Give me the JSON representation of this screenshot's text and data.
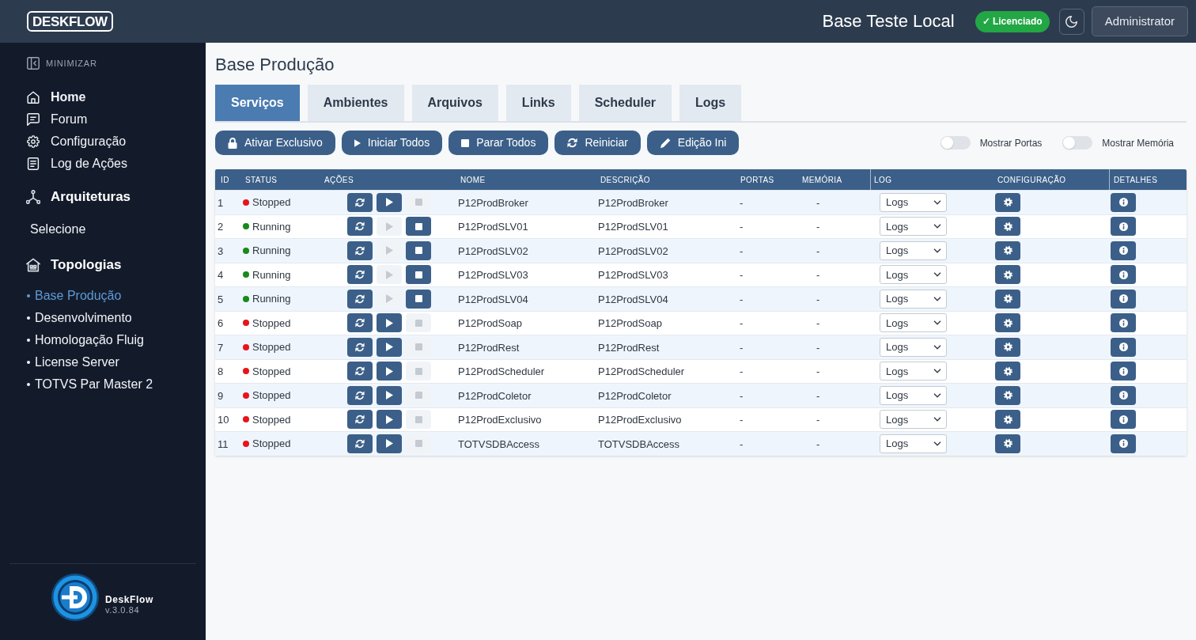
{
  "header": {
    "logo": "DESKFLOW",
    "title": "Base Teste Local",
    "license_badge": "✓ Licenciado",
    "user_button": "Administrator"
  },
  "sidebar": {
    "minimize_label": "MINIMIZAR",
    "nav": [
      {
        "label": "Home",
        "selected": true,
        "kind": "home"
      },
      {
        "label": "Forum",
        "selected": false,
        "kind": "forum"
      },
      {
        "label": "Configuração",
        "selected": false,
        "kind": "settings"
      },
      {
        "label": "Log de Ações",
        "selected": false,
        "kind": "log"
      }
    ],
    "architectures": {
      "title": "Arquiteturas",
      "select_value": "Selecione"
    },
    "topologies": {
      "title": "Topologias",
      "items": [
        {
          "label": "Base Produção",
          "selected": true
        },
        {
          "label": "Desenvolvimento",
          "selected": false
        },
        {
          "label": "Homologação Fluig",
          "selected": false
        },
        {
          "label": "License Server",
          "selected": false
        },
        {
          "label": "TOTVS Par Master 2",
          "selected": false
        }
      ]
    },
    "footer": {
      "app_name": "DeskFlow",
      "version": "v.3.0.84"
    }
  },
  "page": {
    "title": "Base Produção",
    "tabs": [
      {
        "label": "Serviços",
        "selected": true
      },
      {
        "label": "Ambientes",
        "selected": false
      },
      {
        "label": "Arquivos",
        "selected": false
      },
      {
        "label": "Links",
        "selected": false
      },
      {
        "label": "Scheduler",
        "selected": false
      },
      {
        "label": "Logs",
        "selected": false
      }
    ],
    "toolbar": [
      {
        "label": "Ativar Exclusivo",
        "kind": "lock"
      },
      {
        "label": "Iniciar Todos",
        "kind": "start"
      },
      {
        "label": "Parar Todos",
        "kind": "stop"
      },
      {
        "label": "Reiniciar",
        "kind": "restart"
      },
      {
        "label": "Edição Ini",
        "kind": "edit"
      }
    ],
    "toggles": [
      {
        "label": "Mostrar Portas",
        "on": false
      },
      {
        "label": "Mostrar Memória",
        "on": false
      }
    ]
  },
  "table": {
    "columns": [
      "ID",
      "STATUS",
      "AÇÕES",
      "NOME",
      "DESCRIÇÃO",
      "PORTAS",
      "MEMÓRIA",
      "LOG",
      "CONFIGURAÇÃO",
      "DETALHES"
    ],
    "rows": [
      {
        "id": "1",
        "status": "Stopped",
        "color": "#e8141b",
        "running": false,
        "name": "P12ProdBroker",
        "description": "P12ProdBroker",
        "ports": "-",
        "memory": "-",
        "log": "Logs"
      },
      {
        "id": "2",
        "status": "Running",
        "color": "#188a1a",
        "running": true,
        "name": "P12ProdSLV01",
        "description": "P12ProdSLV01",
        "ports": "-",
        "memory": "-",
        "log": "Logs"
      },
      {
        "id": "3",
        "status": "Running",
        "color": "#188a1a",
        "running": true,
        "name": "P12ProdSLV02",
        "description": "P12ProdSLV02",
        "ports": "-",
        "memory": "-",
        "log": "Logs"
      },
      {
        "id": "4",
        "status": "Running",
        "color": "#188a1a",
        "running": true,
        "name": "P12ProdSLV03",
        "description": "P12ProdSLV03",
        "ports": "-",
        "memory": "-",
        "log": "Logs"
      },
      {
        "id": "5",
        "status": "Running",
        "color": "#188a1a",
        "running": true,
        "name": "P12ProdSLV04",
        "description": "P12ProdSLV04",
        "ports": "-",
        "memory": "-",
        "log": "Logs"
      },
      {
        "id": "6",
        "status": "Stopped",
        "color": "#e8141b",
        "running": false,
        "name": "P12ProdSoap",
        "description": "P12ProdSoap",
        "ports": "-",
        "memory": "-",
        "log": "Logs"
      },
      {
        "id": "7",
        "status": "Stopped",
        "color": "#e8141b",
        "running": false,
        "name": "P12ProdRest",
        "description": "P12ProdRest",
        "ports": "-",
        "memory": "-",
        "log": "Logs"
      },
      {
        "id": "8",
        "status": "Stopped",
        "color": "#e8141b",
        "running": false,
        "name": "P12ProdScheduler",
        "description": "P12ProdScheduler",
        "ports": "-",
        "memory": "-",
        "log": "Logs"
      },
      {
        "id": "9",
        "status": "Stopped",
        "color": "#e8141b",
        "running": false,
        "name": "P12ProdColetor",
        "description": "P12ProdColetor",
        "ports": "-",
        "memory": "-",
        "log": "Logs"
      },
      {
        "id": "10",
        "status": "Stopped",
        "color": "#e8141b",
        "running": false,
        "name": "P12ProdExclusivo",
        "description": "P12ProdExclusivo",
        "ports": "-",
        "memory": "-",
        "log": "Logs"
      },
      {
        "id": "11",
        "status": "Stopped",
        "color": "#e8141b",
        "running": false,
        "name": "TOTVSDBAccess",
        "description": "TOTVSDBAccess",
        "ports": "-",
        "memory": "-",
        "log": "Logs"
      }
    ]
  }
}
